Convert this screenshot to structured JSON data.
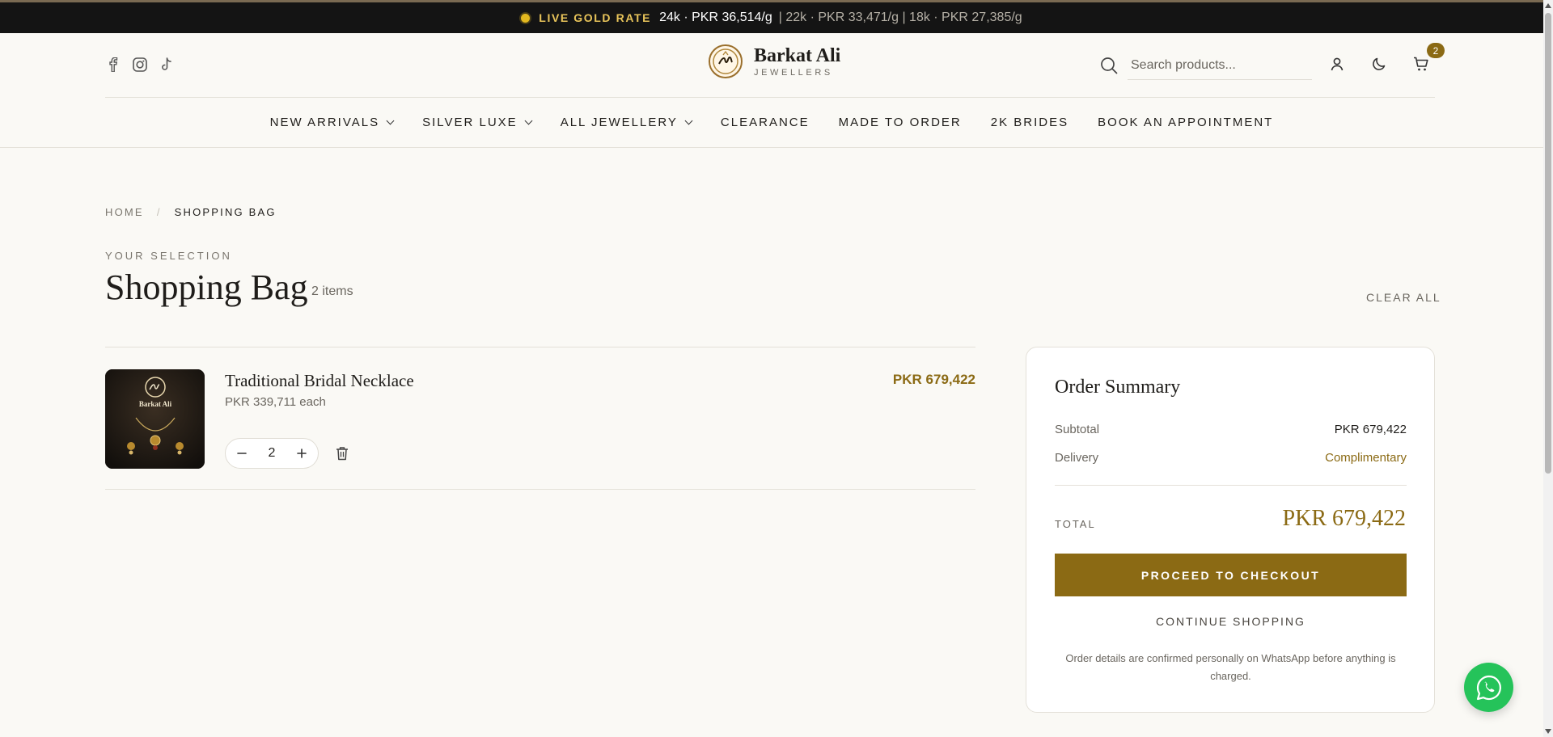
{
  "rate_bar": {
    "live_label": "LIVE GOLD RATE",
    "rate_24k": "24k · PKR 36,514/g",
    "rate_others": "| 22k · PKR 33,471/g | 18k · PKR 27,385/g"
  },
  "header": {
    "brand_name": "Barkat Ali",
    "brand_sub": "JEWELLERS",
    "search_placeholder": "Search products...",
    "cart_count": "2"
  },
  "nav": {
    "items": [
      {
        "label": "NEW ARRIVALS",
        "dropdown": true
      },
      {
        "label": "SILVER LUXE",
        "dropdown": true
      },
      {
        "label": "ALL JEWELLERY",
        "dropdown": true
      },
      {
        "label": "CLEARANCE",
        "dropdown": false
      },
      {
        "label": "MADE TO ORDER",
        "dropdown": false
      },
      {
        "label": "2K BRIDES",
        "dropdown": false
      },
      {
        "label": "BOOK AN APPOINTMENT",
        "dropdown": false
      }
    ]
  },
  "breadcrumb": {
    "home": "HOME",
    "separator": "/",
    "current": "SHOPPING BAG"
  },
  "page": {
    "eyebrow": "YOUR SELECTION",
    "title": "Shopping Bag",
    "item_count": "2 items",
    "clear_all": "CLEAR ALL"
  },
  "cart": {
    "items": [
      {
        "name": "Traditional Bridal Necklace",
        "unit_price": "PKR 339,711 each",
        "line_total": "PKR 679,422",
        "quantity": "2",
        "thumb_label": "Barkat Ali"
      }
    ]
  },
  "summary": {
    "title": "Order Summary",
    "subtotal_label": "Subtotal",
    "subtotal_value": "PKR 679,422",
    "delivery_label": "Delivery",
    "delivery_value": "Complimentary",
    "total_label": "TOTAL",
    "total_value": "PKR 679,422",
    "checkout_label": "PROCEED TO CHECKOUT",
    "continue_label": "CONTINUE SHOPPING",
    "note": "Order details are confirmed personally on WhatsApp before anything is charged."
  },
  "colors": {
    "accent_gold": "#8b6a14",
    "background": "#faf9f5",
    "rate_bar": "#141414",
    "whatsapp": "#25c35a"
  },
  "icons": [
    "facebook-icon",
    "instagram-icon",
    "tiktok-icon",
    "search-icon",
    "user-icon",
    "moon-icon",
    "cart-icon",
    "minus-icon",
    "plus-icon",
    "trash-icon",
    "whatsapp-icon"
  ]
}
